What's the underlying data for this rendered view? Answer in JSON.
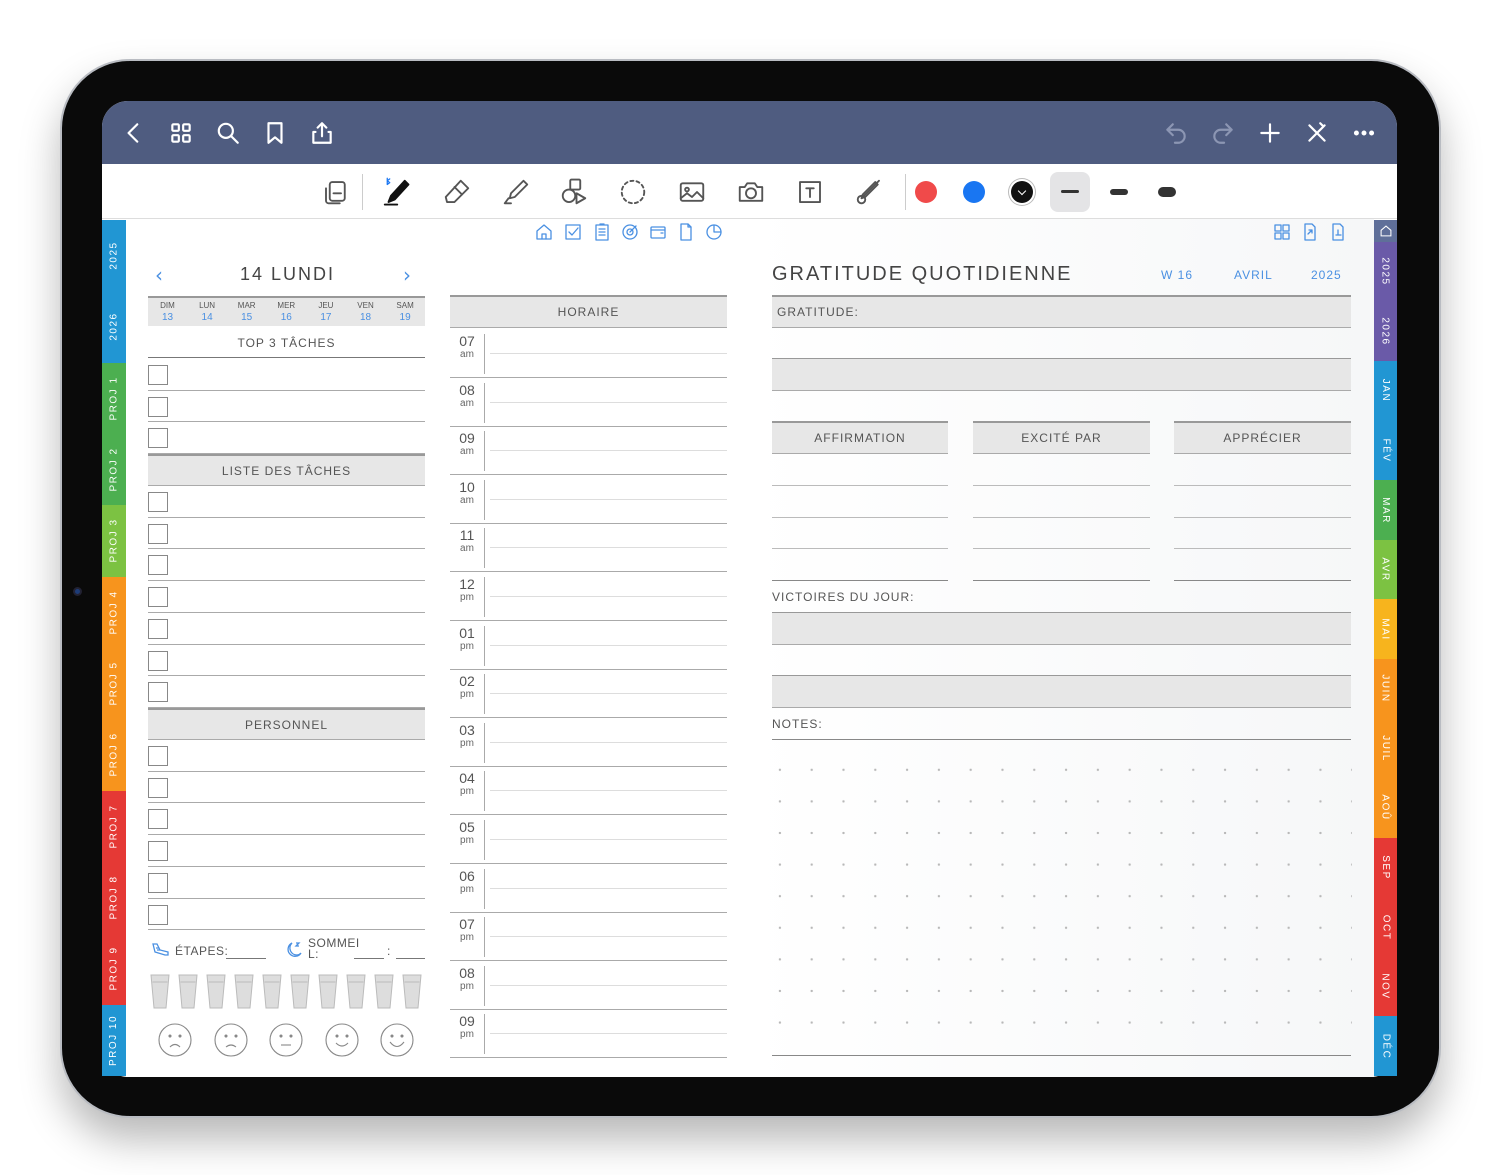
{
  "colors": {
    "accent": "#4a90e2",
    "topbar": "#4f5c80",
    "pen_red": "#f04a4a",
    "pen_blue": "#1976f2",
    "pen_black": "#111111"
  },
  "topbar": {
    "left_icons": [
      "back-icon",
      "grid-icon",
      "search-icon",
      "bookmark-icon",
      "share-icon"
    ],
    "right_icons": [
      "undo-icon",
      "redo-icon",
      "plus-icon",
      "close-icon",
      "more-icon"
    ]
  },
  "toolbar": {
    "tools": [
      "read-mode-icon",
      "pen-icon",
      "eraser-icon",
      "highlighter-icon",
      "shapes-icon",
      "lasso-icon",
      "image-icon",
      "camera-icon",
      "textbox-icon",
      "laser-icon"
    ],
    "colors": [
      "red",
      "blue",
      "black"
    ],
    "stroke_widths": [
      "thin",
      "medium",
      "thick"
    ]
  },
  "left_tabs": [
    "2025",
    "2026",
    "PROJ 1",
    "PROJ 2",
    "PROJ 3",
    "PROJ 4",
    "PROJ 5",
    "PROJ 6",
    "PROJ 7",
    "PROJ 8",
    "PROJ 9",
    "PROJ 10"
  ],
  "right_tabs": [
    "2025",
    "2026",
    "JAN",
    "FÉV",
    "MAR",
    "AVR",
    "MAI",
    "JUIN",
    "JUIL",
    "AOÛ",
    "SEP",
    "OCT",
    "NOV",
    "DÉC"
  ],
  "day": {
    "date_title": "14 LUNDI",
    "week": [
      {
        "d": "DIM",
        "n": "13"
      },
      {
        "d": "LUN",
        "n": "14"
      },
      {
        "d": "MAR",
        "n": "15"
      },
      {
        "d": "MER",
        "n": "16"
      },
      {
        "d": "JEU",
        "n": "17"
      },
      {
        "d": "VEN",
        "n": "18"
      },
      {
        "d": "SAM",
        "n": "19"
      }
    ],
    "top3_title": "TOP 3 TÂCHES",
    "tasks_title": "LISTE DES TÂCHES",
    "personal_title": "PERSONNEL",
    "steps_label": "ÉTAPES:",
    "sleep_label": "SOMMEI\nL:",
    "sleep_colon": ":",
    "schedule_title": "HORAIRE",
    "hours": [
      {
        "n": "07",
        "p": "am"
      },
      {
        "n": "08",
        "p": "am"
      },
      {
        "n": "09",
        "p": "am"
      },
      {
        "n": "10",
        "p": "am"
      },
      {
        "n": "11",
        "p": "am"
      },
      {
        "n": "12",
        "p": "pm"
      },
      {
        "n": "01",
        "p": "pm"
      },
      {
        "n": "02",
        "p": "pm"
      },
      {
        "n": "03",
        "p": "pm"
      },
      {
        "n": "04",
        "p": "pm"
      },
      {
        "n": "05",
        "p": "pm"
      },
      {
        "n": "06",
        "p": "pm"
      },
      {
        "n": "07",
        "p": "pm"
      },
      {
        "n": "08",
        "p": "pm"
      },
      {
        "n": "09",
        "p": "pm"
      }
    ]
  },
  "gratitude": {
    "title": "GRATITUDE QUOTIDIENNE",
    "week": "W 16",
    "month": "AVRIL",
    "year": "2025",
    "gratitude_label": "GRATITUDE:",
    "affirmation": "AFFIRMATION",
    "excited": "EXCITÉ PAR",
    "appreciate": "APPRÉCIER",
    "victories": "VICTOIRES DU JOUR:",
    "notes": "NOTES:"
  }
}
